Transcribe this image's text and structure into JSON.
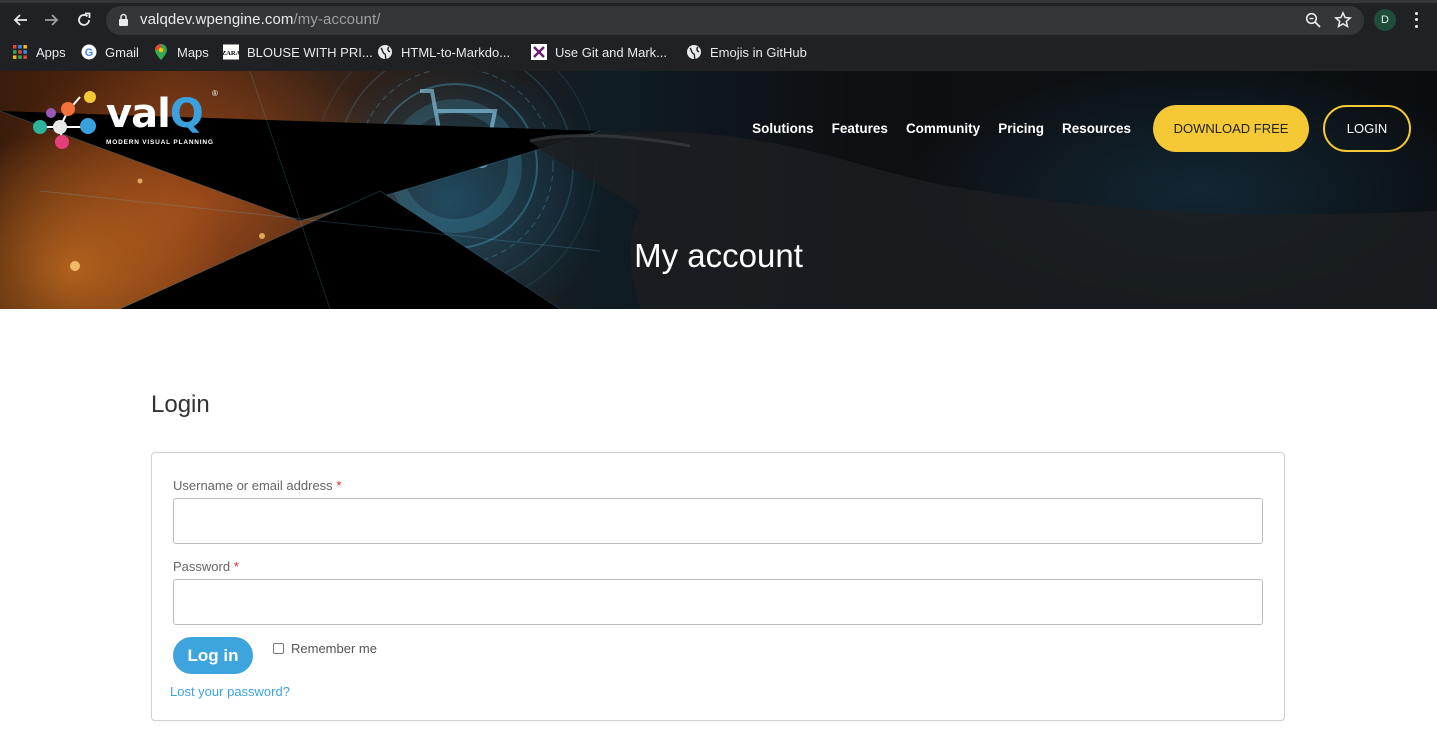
{
  "browser": {
    "url_host": "valqdev.wpengine.com",
    "url_path": "/my-account/",
    "profile_initial": "D",
    "bookmarks": [
      {
        "label": "Apps",
        "icon": "apps-grid-icon"
      },
      {
        "label": "Gmail",
        "icon": "google-icon"
      },
      {
        "label": "Maps",
        "icon": "maps-pin-icon"
      },
      {
        "label": "BLOUSE WITH PRI...",
        "icon": "zara-icon"
      },
      {
        "label": "HTML-to-Markdo...",
        "icon": "globe-icon"
      },
      {
        "label": "Use Git and Mark...",
        "icon": "x-box-icon"
      },
      {
        "label": "Emojis in GitHub",
        "icon": "globe-icon"
      }
    ]
  },
  "site": {
    "logo": {
      "word_prefix": "val",
      "word_q": "Q",
      "reg": "®",
      "tagline": "MODERN VISUAL PLANNING"
    },
    "nav": [
      "Solutions",
      "Features",
      "Community",
      "Pricing",
      "Resources"
    ],
    "download_label": "DOWNLOAD FREE",
    "login_label": "LOGIN",
    "hero_title": "My account"
  },
  "login_form": {
    "section_title": "Login",
    "username_label": "Username or email address",
    "password_label": "Password",
    "required_mark": "*",
    "submit_label": "Log in",
    "remember_label": "Remember me",
    "lost_password": "Lost your password?"
  },
  "colors": {
    "accent_yellow": "#f4c935",
    "accent_blue": "#3ea4dd",
    "required_red": "#e2231a",
    "chrome_bg": "#202124"
  }
}
